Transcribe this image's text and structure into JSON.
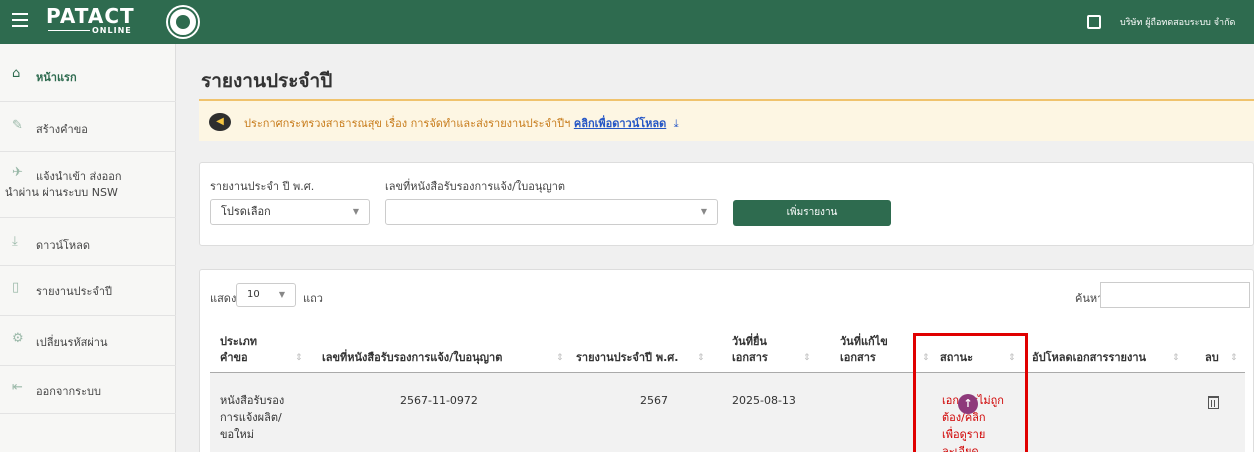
{
  "header": {
    "logo_text": "PATACT",
    "logo_sub": "ONLINE",
    "company": "บริษัท ผู้ถือทดสอบระบบ จำกัด"
  },
  "sidebar": {
    "items": [
      {
        "label": "หน้าแรก",
        "icon": "home-icon"
      },
      {
        "label": "สร้างคำขอ",
        "icon": "pencil-icon"
      },
      {
        "label": "แจ้งนำเข้า ส่งออก",
        "label2": "นำผ่าน ผ่านระบบ NSW",
        "icon": "plane-icon"
      },
      {
        "label": "ดาวน์โหลด",
        "icon": "download-icon"
      },
      {
        "label": "รายงานประจำปี",
        "icon": "document-icon"
      },
      {
        "label": "เปลี่ยนรหัสผ่าน",
        "icon": "gears-icon"
      },
      {
        "label": "ออกจากระบบ",
        "icon": "logout-icon"
      }
    ]
  },
  "page": {
    "title": "รายงานประจำปี"
  },
  "notice": {
    "text": "ประกาศกระทรวงสาธารณสุข เรื่อง การจัดทำและส่งรายงานประจำปีฯ",
    "link": "คลิกเพื่อดาวน์โหลด"
  },
  "filters": {
    "year_label": "รายงานประจำ ปี พ.ศ.",
    "year_value": "โปรดเลือก",
    "license_label": "เลขที่หนังสือรับรองการแจ้ง/ใบอนุญาต",
    "license_value": "",
    "add_button": "เพิ่มรายงาน"
  },
  "table": {
    "show_label": "แสดง",
    "page_length": "10",
    "rows_label": "แถว",
    "search_label": "ค้นหา:",
    "search_value": "",
    "headers": {
      "type_l1": "ประเภท",
      "type_l2": "คำขอ",
      "license": "เลขที่หนังสือรับรองการแจ้ง/ใบอนุญาต",
      "year": "รายงานประจำปี พ.ศ.",
      "submit_l1": "วันที่ยื่น",
      "submit_l2": "เอกสาร",
      "edit_l1": "วันที่แก้ไข",
      "edit_l2": "เอกสาร",
      "status": "สถานะ",
      "upload": "อัปโหลดเอกสารรายงาน",
      "delete": "ลบ"
    },
    "rows": [
      {
        "type_l1": "หนังสือรับรอง",
        "type_l2": "การแจ้งผลิต/",
        "type_l3": "ขอใหม่",
        "license": "2567-11-0972",
        "year": "2567",
        "submit_date": "2025-08-13",
        "edit_date": "",
        "status_l1": "เอกสารไม่ถูก",
        "status_l2": "ต้อง/คลิก",
        "status_l3": "เพื่อดูราย",
        "status_l4": "ละเอียด"
      }
    ]
  },
  "colors": {
    "primary": "#2e6b4f",
    "status_error": "#d00000",
    "highlight_box": "#e00000",
    "upload_icon": "#8e3a7b"
  }
}
